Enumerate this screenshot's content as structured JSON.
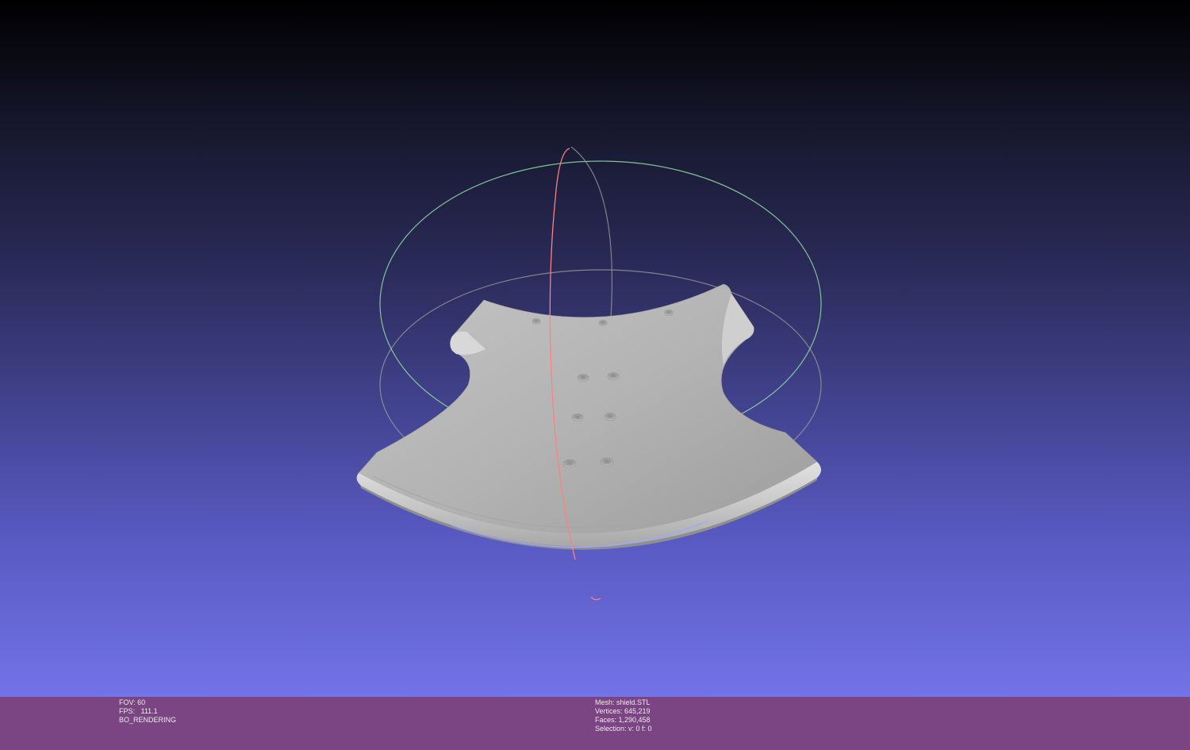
{
  "viewport": {
    "mesh_color": "#bdbdbd",
    "trackball": {
      "ring_x_color": "#ff8080",
      "ring_y_color": "#8fe0a0",
      "ring_z_color": "#a0a8ff",
      "ring_gray_color": "#9a9a9a"
    }
  },
  "info_left": {
    "fov": "FOV: 60",
    "fps": "FPS:   111.1",
    "render_mode": "BO_RENDERING"
  },
  "info_right": {
    "mesh": "Mesh: shield.STL",
    "vertices": "Vertices: 645,219",
    "faces": "Faces: 1,290,458",
    "selection": "Selection: v: 0 f: 0"
  }
}
